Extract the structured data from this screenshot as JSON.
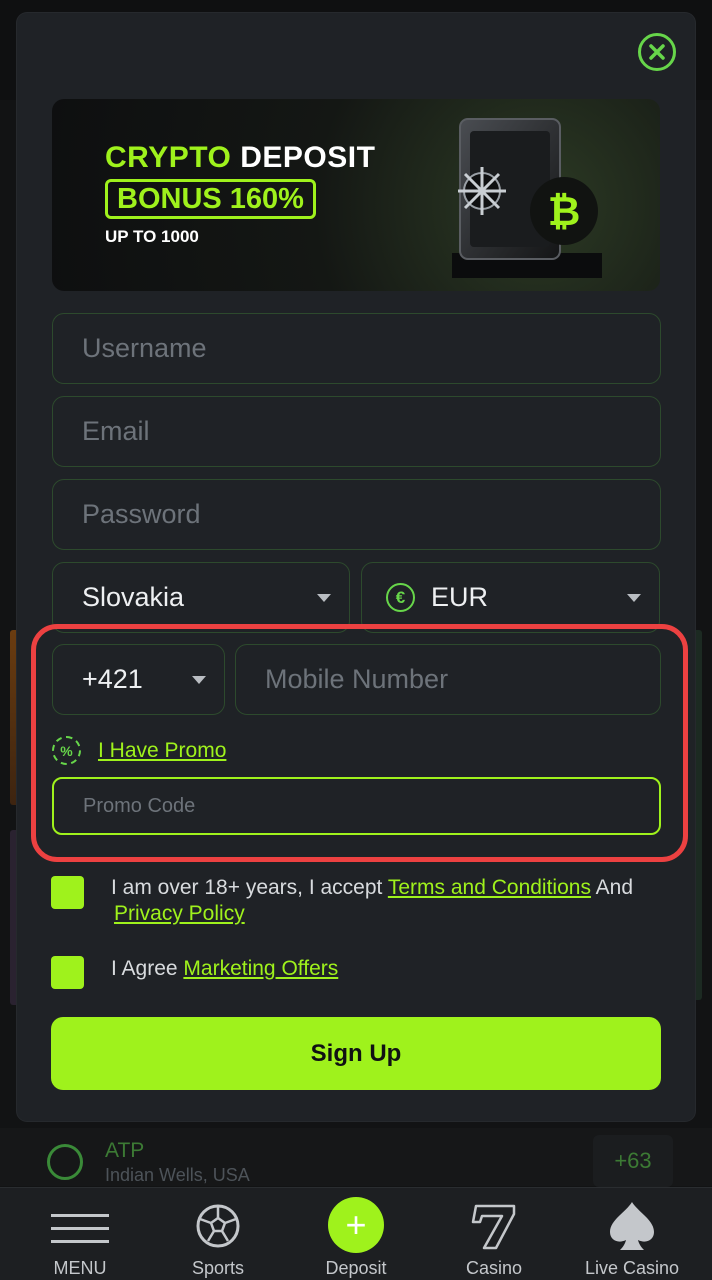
{
  "banner": {
    "line1_green": "CRYPTO",
    "line1_white": "DEPOSIT",
    "bonus": "BONUS 160%",
    "subtitle": "UP TO 1000",
    "coin_symbol": "₿"
  },
  "form": {
    "username_placeholder": "Username",
    "email_placeholder": "Email",
    "password_placeholder": "Password",
    "country_value": "Slovakia",
    "currency_value": "EUR",
    "currency_symbol": "€",
    "phone_code": "+421",
    "mobile_placeholder": "Mobile Number",
    "promo_link": "I Have Promo",
    "promo_icon_glyph": "%",
    "promo_placeholder": "Promo Code",
    "terms_prefix": "I am over 18+ years, I accept",
    "terms_link": "Terms and Conditions",
    "terms_mid": "And",
    "privacy_link": "Privacy Policy",
    "marketing_prefix": "I Agree",
    "marketing_link": "Marketing Offers",
    "signup_label": "Sign Up"
  },
  "background_event": {
    "title": "ATP",
    "subtitle": "Indian Wells, USA",
    "odds": "+63"
  },
  "bottom_nav": [
    {
      "label": "MENU",
      "icon": "hamburger-icon"
    },
    {
      "label": "Sports",
      "icon": "soccer-ball-icon"
    },
    {
      "label": "Deposit",
      "icon": "plus-icon"
    },
    {
      "label": "Casino",
      "icon": "seven-icon"
    },
    {
      "label": "Live Casino",
      "icon": "spade-icon"
    }
  ],
  "colors": {
    "accent": "#9ff21c",
    "highlight": "#ec4141",
    "modal_bg": "#1f2226"
  }
}
